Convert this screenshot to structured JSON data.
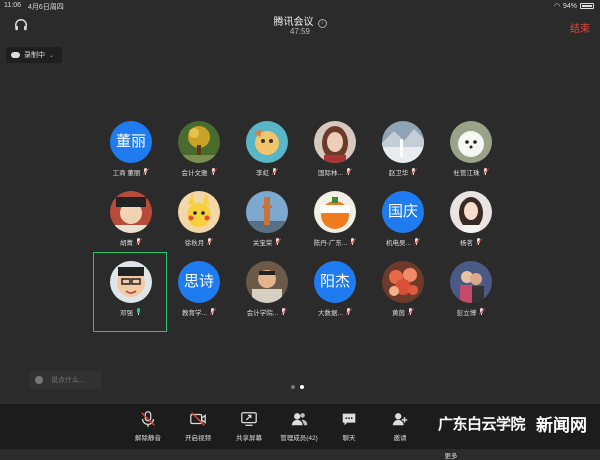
{
  "statusbar": {
    "time": "11:06",
    "date": "4月6日周四",
    "battery": "94%"
  },
  "header": {
    "title": "腾讯会议",
    "timer": "47:59",
    "end_label": "结束"
  },
  "recording": {
    "label": "录制中"
  },
  "participants": [
    {
      "name": "工商 董丽",
      "avatar_text": "董丽",
      "mic": "muted"
    },
    {
      "name": "会计文雅",
      "avatar_text": "",
      "mic": "muted"
    },
    {
      "name": "李虹",
      "avatar_text": "",
      "mic": "muted"
    },
    {
      "name": "国际林...",
      "avatar_text": "",
      "mic": "muted"
    },
    {
      "name": "赵卫华",
      "avatar_text": "",
      "mic": "muted"
    },
    {
      "name": "杜管江珠",
      "avatar_text": "",
      "mic": "muted"
    },
    {
      "name": "胡菁",
      "avatar_text": "",
      "mic": "muted"
    },
    {
      "name": "徐秋月",
      "avatar_text": "",
      "mic": "muted"
    },
    {
      "name": "关宝荣",
      "avatar_text": "",
      "mic": "muted"
    },
    {
      "name": "陈丹-广东...",
      "avatar_text": "",
      "mic": "muted"
    },
    {
      "name": "机电吴...",
      "avatar_text": "国庆",
      "mic": "muted"
    },
    {
      "name": "杨茗",
      "avatar_text": "",
      "mic": "muted"
    },
    {
      "name": "邓强",
      "avatar_text": "",
      "mic": "on"
    },
    {
      "name": "教育学...",
      "avatar_text": "思诗",
      "mic": "muted"
    },
    {
      "name": "会计学院...",
      "avatar_text": "",
      "mic": "muted"
    },
    {
      "name": "大数据...",
      "avatar_text": "阳杰",
      "mic": "muted"
    },
    {
      "name": "黄茵",
      "avatar_text": "",
      "mic": "muted"
    },
    {
      "name": "彭立博",
      "avatar_text": "",
      "mic": "muted"
    }
  ],
  "chat": {
    "placeholder": "说点什么..."
  },
  "toolbar": {
    "unmute": "解除静音",
    "video": "开启视频",
    "share": "共享屏幕",
    "members": "管理成员(42)",
    "chat": "聊天",
    "invite": "邀请",
    "more": "更多"
  },
  "watermarks": {
    "left": "广东白云学院",
    "right": "新闻网"
  },
  "colors": {
    "accent": "#1f7bf0",
    "end": "#e6453c",
    "active": "#26c36a"
  }
}
